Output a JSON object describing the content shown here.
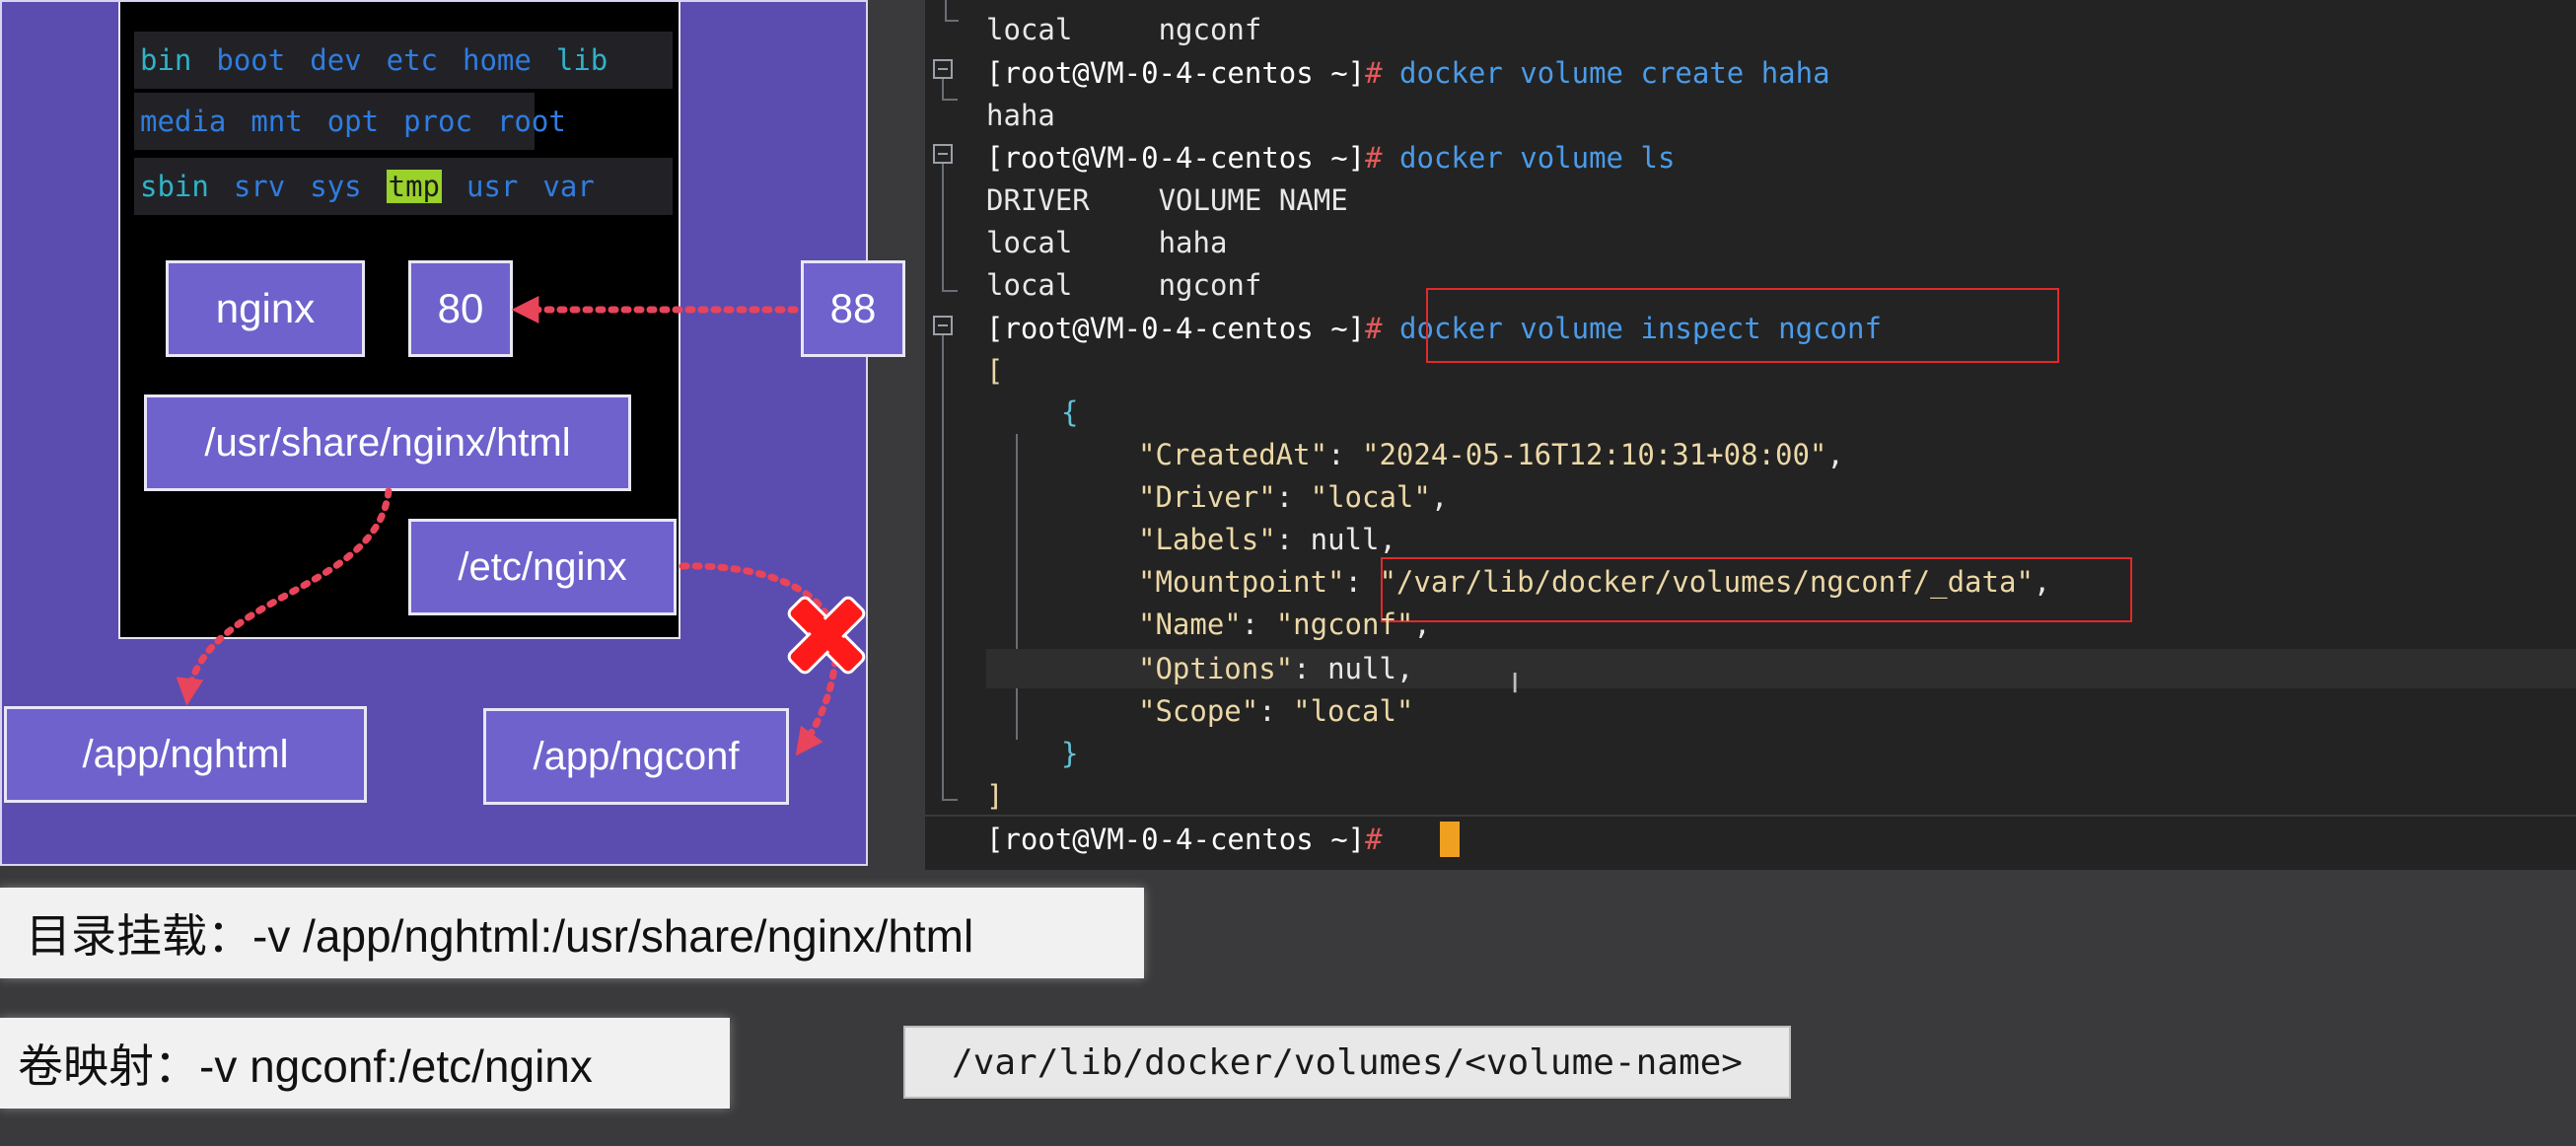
{
  "diagram": {
    "dirs_row1": [
      "bin",
      "boot",
      "dev",
      "etc",
      "home",
      "lib"
    ],
    "dirs_row2": [
      "media",
      "mnt",
      "opt",
      "proc",
      "root"
    ],
    "dirs_row3": [
      "sbin",
      "srv",
      "sys",
      "tmp",
      "usr",
      "var"
    ],
    "app_label": "nginx",
    "container_port": "80",
    "host_port": "88",
    "html_path": "/usr/share/nginx/html",
    "conf_path": "/etc/nginx",
    "host_html": "/app/nghtml",
    "host_conf": "/app/ngconf",
    "colors": {
      "panel": "#5b4db0",
      "box": "#6f62cc",
      "arrow": "#e8445a",
      "x_mark": "#ff1a1a"
    }
  },
  "terminal": {
    "prompt": "[root@VM-0-4-centos ~]",
    "hash": "#",
    "lines": {
      "l0": "local     ngconf",
      "cmd1": "docker volume create haha",
      "out1": "haha",
      "cmd2": "docker volume ls",
      "hdr": "DRIVER    VOLUME NAME",
      "r1": "local     haha",
      "r2": "local     ngconf",
      "cmd3": "docker volume inspect ngconf",
      "open_bracket": "[",
      "open_brace": "{",
      "created_key": "\"CreatedAt\"",
      "created_val": "\"2024-05-16T12:10:31+08:00\"",
      "driver_key": "\"Driver\"",
      "driver_val": "\"local\"",
      "labels_key": "\"Labels\"",
      "labels_val": "null,",
      "mount_key": "\"Mountpoint\"",
      "mount_val": "\"/var/lib/docker/volumes/ngconf/_data\"",
      "name_key": "\"Name\"",
      "name_val": "\"ngconf\"",
      "options_key": "\"Options\"",
      "options_val": "null,",
      "scope_key": "\"Scope\"",
      "scope_val": "\"local\"",
      "close_brace": "}",
      "close_bracket": "]"
    },
    "colors": {
      "bg": "#232323",
      "command": "#4b9be8",
      "hash": "#e05a5a",
      "string": "#ecd8a6",
      "highlight_box": "#e02a2a",
      "cursor": "#f0a020"
    }
  },
  "captions": {
    "bind_mount": "目录挂载：-v /app/nghtml:/usr/share/nginx/html",
    "volume_map": "卷映射：-v ngconf:/etc/nginx",
    "volume_path": "/var/lib/docker/volumes/<volume-name>"
  }
}
